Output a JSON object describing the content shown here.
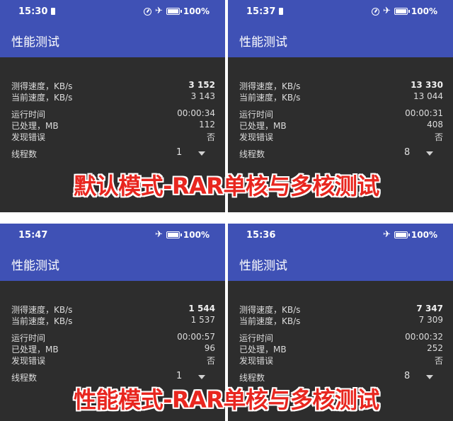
{
  "app_title": "性能测试",
  "labels": {
    "measured_speed": "测得速度，KB/s",
    "current_speed": "当前速度，KB/s",
    "run_time": "运行时间",
    "processed": "已处理，MB",
    "errors_found": "发现错误",
    "threads": "线程数"
  },
  "status_battery": "100%",
  "panels": [
    {
      "time": "15:30",
      "measured": "3 152",
      "current": "3 143",
      "run_time": "00:00:34",
      "processed": "112",
      "errors": "否",
      "threads": "1"
    },
    {
      "time": "15:37",
      "measured": "13 330",
      "current": "13 044",
      "run_time": "00:00:31",
      "processed": "408",
      "errors": "否",
      "threads": "8"
    },
    {
      "time": "15:47",
      "measured": "1 544",
      "current": "1 537",
      "run_time": "00:00:57",
      "processed": "96",
      "errors": "否",
      "threads": "1"
    },
    {
      "time": "15:36",
      "measured": "7 347",
      "current": "7 309",
      "run_time": "00:00:32",
      "processed": "252",
      "errors": "否",
      "threads": "8"
    }
  ],
  "overlays": [
    "默认模式-RAR单核与多核测试",
    "性能模式-RAR单核与多核测试"
  ],
  "colors": {
    "appbar": "#3f51b5",
    "background": "#2d2d2d",
    "overlay_text": "#e8261f"
  },
  "icons": [
    "speed-gauge-icon",
    "airplane-mode-icon",
    "battery-icon",
    "dropdown-arrow-icon",
    "notification-icon"
  ]
}
